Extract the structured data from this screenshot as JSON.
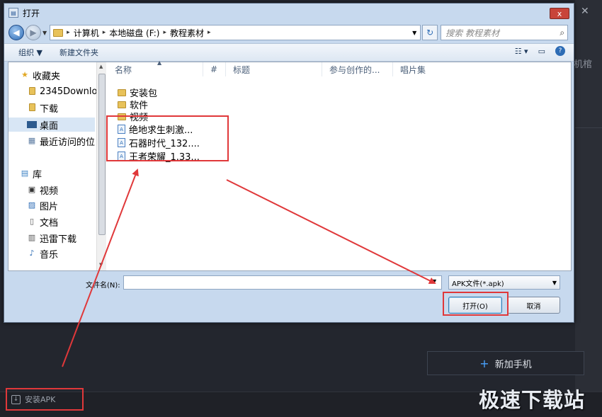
{
  "background": {
    "side_text": "机棺",
    "install_button": "安装APK",
    "add_phone_button": "新加手机",
    "watermark": "极速下载站"
  },
  "dialog": {
    "title": "打开",
    "close": "x",
    "breadcrumb": [
      "计算机",
      "本地磁盘 (F:)",
      "教程素材"
    ],
    "search_placeholder": "搜索 教程素材",
    "toolbar": {
      "organize": "组织 ▼",
      "new_folder": "新建文件夹"
    },
    "nav_pane": {
      "favorites_label": "收藏夹",
      "favorites": [
        "2345Downlo",
        "下载",
        "桌面",
        "最近访问的位"
      ],
      "libraries_label": "库",
      "libraries": [
        "视频",
        "图片",
        "文档",
        "迅雷下载",
        "音乐"
      ]
    },
    "columns": [
      "名称",
      "#",
      "标题",
      "参与创作的...",
      "唱片集"
    ],
    "folders": [
      "安装包",
      "软件",
      "视频"
    ],
    "apk_files": [
      "绝地求生刺激...",
      "石器时代_132....",
      "王者荣耀_1.33..."
    ],
    "file_name_label": "文件名(N):",
    "file_name_value": "",
    "file_type": "APK文件(*.apk)",
    "open_button": "打开(O)",
    "cancel_button": "取消"
  },
  "colors": {
    "highlight": "#e0383a",
    "title_close": "#c8443a",
    "dialog_frame": "#c7d9ee",
    "app_background": "#23262e"
  }
}
